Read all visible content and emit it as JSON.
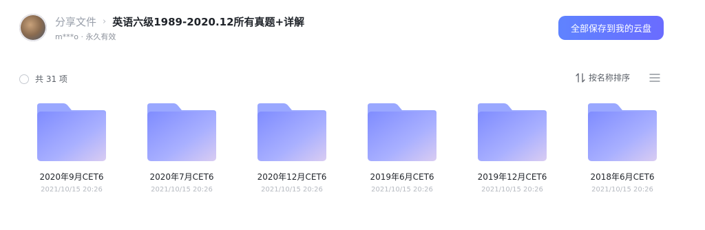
{
  "header": {
    "breadcrumb_root": "分享文件",
    "breadcrumb_separator": "›",
    "title": "英语六级1989-2020.12所有真题+详解",
    "meta": "m***o · 永久有效"
  },
  "actions": {
    "save_label": "全部保存到我的云盘"
  },
  "toolbar": {
    "count_label": "共 31 项",
    "sort_label": "按名称排序"
  },
  "colors": {
    "accent": "#6279ff",
    "folder_back": "#9aa8ff",
    "folder_front": "#b3b7ff"
  },
  "files": [
    {
      "name": "2020年9月CET6",
      "time": "2021/10/15 20:26"
    },
    {
      "name": "2020年7月CET6",
      "time": "2021/10/15 20:26"
    },
    {
      "name": "2020年12月CET6",
      "time": "2021/10/15 20:26"
    },
    {
      "name": "2019年6月CET6",
      "time": "2021/10/15 20:26"
    },
    {
      "name": "2019年12月CET6",
      "time": "2021/10/15 20:26"
    },
    {
      "name": "2018年6月CET6",
      "time": "2021/10/15 20:26"
    }
  ]
}
